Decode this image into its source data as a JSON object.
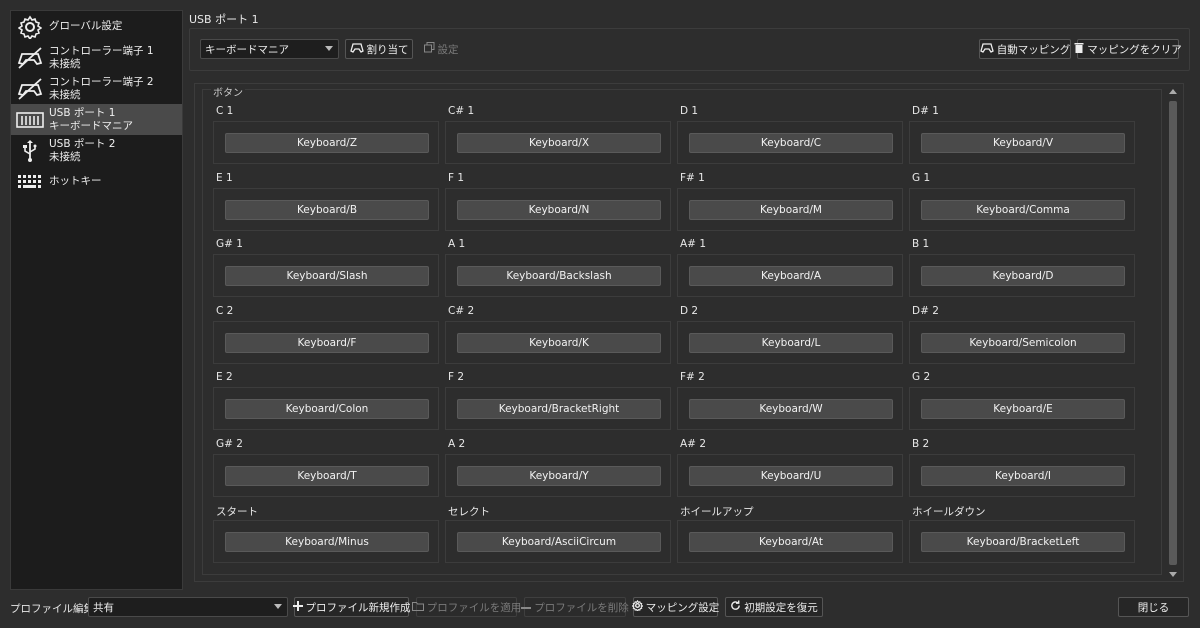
{
  "sidebar": {
    "items": [
      {
        "icon": "gear-icon",
        "line1": "グローバル設定",
        "line2": ""
      },
      {
        "icon": "gamepad-disconnected-icon",
        "line1": "コントローラー端子 1",
        "line2": "未接続"
      },
      {
        "icon": "gamepad-disconnected-icon",
        "line1": "コントローラー端子 2",
        "line2": "未接続"
      },
      {
        "icon": "keyboard-mania-icon",
        "line1": "USB ポート 1",
        "line2": "キーボードマニア"
      },
      {
        "icon": "usb-icon",
        "line1": "USB ポート 2",
        "line2": "未接続"
      },
      {
        "icon": "hotkey-icon",
        "line1": "ホットキー",
        "line2": ""
      }
    ]
  },
  "header": {
    "title": "USB ポート 1",
    "device_select": "キーボードマニア",
    "assign_label": "割り当て",
    "settings_label": "設定",
    "auto_mapping_label": "自動マッピング",
    "clear_mapping_label": "マッピングをクリア"
  },
  "group_title": "ボタン",
  "keys": [
    {
      "label": "C 1",
      "binding": "Keyboard/Z"
    },
    {
      "label": "C# 1",
      "binding": "Keyboard/X"
    },
    {
      "label": "D 1",
      "binding": "Keyboard/C"
    },
    {
      "label": "D# 1",
      "binding": "Keyboard/V"
    },
    {
      "label": "E 1",
      "binding": "Keyboard/B"
    },
    {
      "label": "F 1",
      "binding": "Keyboard/N"
    },
    {
      "label": "F# 1",
      "binding": "Keyboard/M"
    },
    {
      "label": "G 1",
      "binding": "Keyboard/Comma"
    },
    {
      "label": "G# 1",
      "binding": "Keyboard/Slash"
    },
    {
      "label": "A 1",
      "binding": "Keyboard/Backslash"
    },
    {
      "label": "A# 1",
      "binding": "Keyboard/A"
    },
    {
      "label": "B 1",
      "binding": "Keyboard/D"
    },
    {
      "label": "C 2",
      "binding": "Keyboard/F"
    },
    {
      "label": "C# 2",
      "binding": "Keyboard/K"
    },
    {
      "label": "D 2",
      "binding": "Keyboard/L"
    },
    {
      "label": "D# 2",
      "binding": "Keyboard/Semicolon"
    },
    {
      "label": "E 2",
      "binding": "Keyboard/Colon"
    },
    {
      "label": "F 2",
      "binding": "Keyboard/BracketRight"
    },
    {
      "label": "F# 2",
      "binding": "Keyboard/W"
    },
    {
      "label": "G 2",
      "binding": "Keyboard/E"
    },
    {
      "label": "G# 2",
      "binding": "Keyboard/T"
    },
    {
      "label": "A 2",
      "binding": "Keyboard/Y"
    },
    {
      "label": "A# 2",
      "binding": "Keyboard/U"
    },
    {
      "label": "B 2",
      "binding": "Keyboard/I"
    },
    {
      "label": "スタート",
      "binding": "Keyboard/Minus"
    },
    {
      "label": "セレクト",
      "binding": "Keyboard/AsciiCircum"
    },
    {
      "label": "ホイールアップ",
      "binding": "Keyboard/At"
    },
    {
      "label": "ホイールダウン",
      "binding": "Keyboard/BracketLeft"
    }
  ],
  "footer": {
    "profile_label": "プロファイル編集:",
    "profile_value": "共有",
    "new_profile": "プロファイル新規作成",
    "apply_profile": "プロファイルを適用",
    "delete_profile": "プロファイルを削除",
    "mapping_settings": "マッピング設定",
    "restore_defaults": "初期設定を復元",
    "close": "閉じる"
  }
}
